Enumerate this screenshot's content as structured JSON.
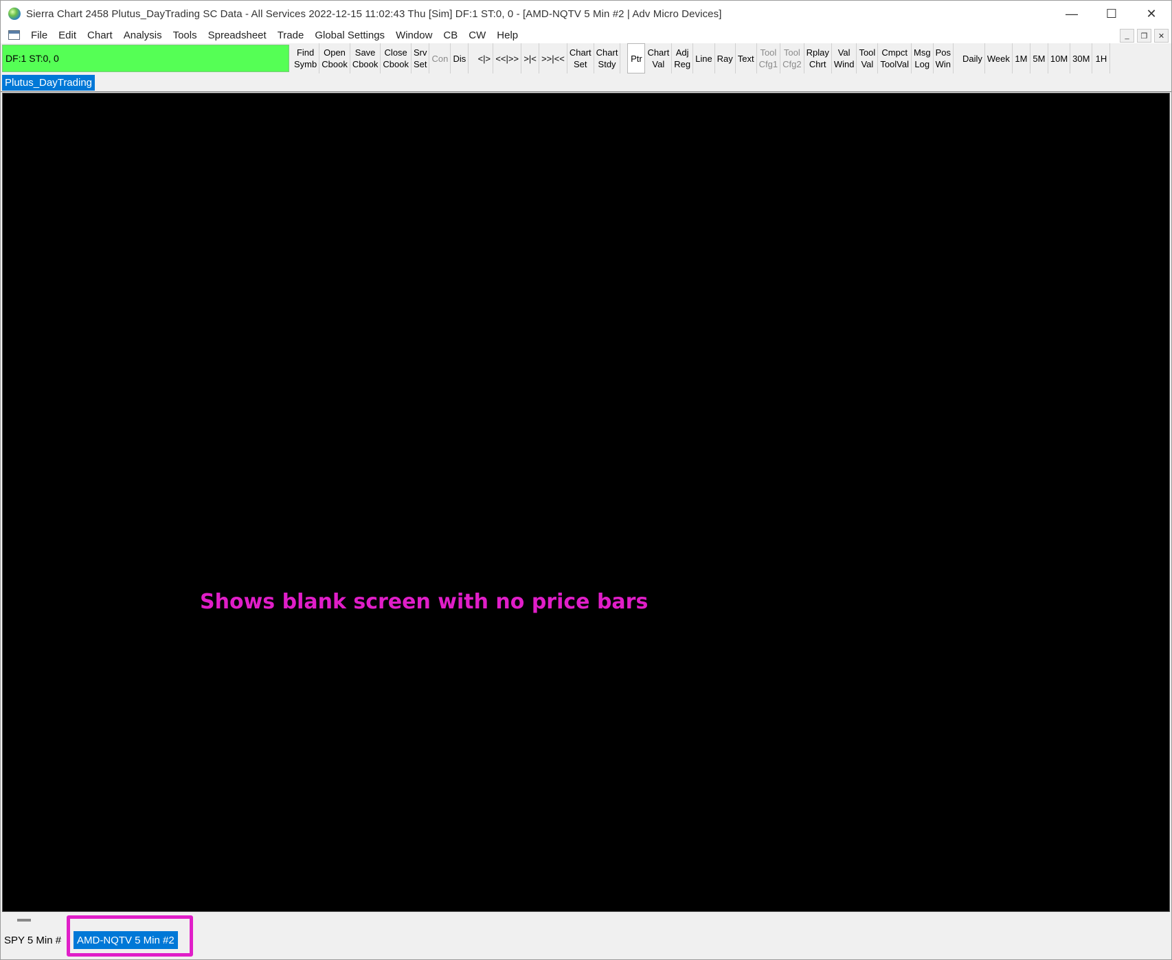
{
  "window": {
    "title": "Sierra Chart 2458 Plutus_DayTrading  SC Data - All Services 2022-12-15  11:02:43 Thu [Sim]  DF:1  ST:0, 0 - [AMD-NQTV  5 Min  #2 | Adv Micro Devices]",
    "controls": {
      "minimize": "—",
      "maximize": "☐",
      "close": "✕"
    }
  },
  "menu": {
    "items": [
      "File",
      "Edit",
      "Chart",
      "Analysis",
      "Tools",
      "Spreadsheet",
      "Trade",
      "Global Settings",
      "Window",
      "CB",
      "CW",
      "Help"
    ],
    "mdi": {
      "minimize": "_",
      "restore": "❐",
      "close": "✕"
    }
  },
  "toolbar": {
    "status": "DF:1  ST:0, 0",
    "groups": [
      [
        {
          "label": "Find\nSymb"
        },
        {
          "label": "Open\nCbook"
        },
        {
          "label": "Save\nCbook"
        },
        {
          "label": "Close\nCbook"
        },
        {
          "label": "Srv\nSet"
        },
        {
          "label": "Con",
          "disabled": true
        },
        {
          "label": "Dis"
        }
      ],
      [
        {
          "label": "<|>"
        },
        {
          "label": "<<|>>"
        },
        {
          "label": ">|<"
        },
        {
          "label": ">>|<<"
        },
        {
          "label": "Chart\nSet"
        },
        {
          "label": "Chart\nStdy"
        }
      ],
      [
        {
          "label": "Ptr",
          "selected": true
        },
        {
          "label": "Chart\nVal"
        },
        {
          "label": "Adj\nReg"
        },
        {
          "label": "Line"
        },
        {
          "label": "Ray"
        },
        {
          "label": "Text"
        },
        {
          "label": "Tool\nCfg1",
          "disabled": true
        },
        {
          "label": "Tool\nCfg2",
          "disabled": true
        },
        {
          "label": "Rplay\nChrt"
        },
        {
          "label": "Val\nWind"
        },
        {
          "label": "Tool\nVal"
        },
        {
          "label": "Cmpct\nToolVal"
        },
        {
          "label": "Msg\nLog"
        },
        {
          "label": "Pos\nWin"
        }
      ],
      [
        {
          "label": "Daily"
        },
        {
          "label": "Week"
        },
        {
          "label": "1M"
        },
        {
          "label": "5M"
        },
        {
          "label": "10M"
        },
        {
          "label": "30M"
        },
        {
          "label": "1H"
        }
      ]
    ]
  },
  "chartbook_tab": "Plutus_DayTrading",
  "annotation": "Shows blank screen with no price bars",
  "bottom_tabs": {
    "inactive": "SPY  5 Min   #",
    "active": "AMD-NQTV  5 Min   #2"
  },
  "colors": {
    "status_green": "#55ff55",
    "accent_blue": "#0078d7",
    "annotation_magenta": "#e01ec8",
    "chart_background": "#000000"
  }
}
